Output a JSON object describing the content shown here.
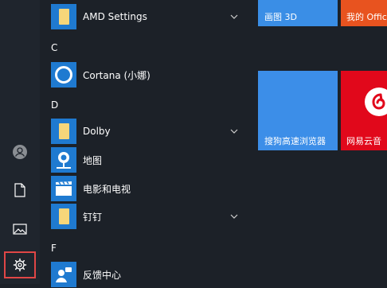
{
  "rail": {
    "items": [
      {
        "name": "user-account-button",
        "icon": "user-icon"
      },
      {
        "name": "documents-button",
        "icon": "document-icon"
      },
      {
        "name": "pictures-button",
        "icon": "image-icon"
      },
      {
        "name": "settings-button",
        "icon": "gear-icon",
        "highlighted": true
      }
    ]
  },
  "applist": {
    "amd": {
      "label": "AMD Settings",
      "icon": "folder-icon"
    },
    "header_c": "C",
    "cortana": {
      "label": "Cortana (小娜)",
      "icon": "cortana-ring-icon"
    },
    "header_d": "D",
    "dolby": {
      "label": "Dolby",
      "icon": "folder-icon"
    },
    "maps": {
      "label": "地图",
      "icon": "map-pin-icon"
    },
    "movies": {
      "label": "电影和电视",
      "icon": "clapperboard-icon"
    },
    "dingtalk": {
      "label": "钉钉",
      "icon": "folder-icon"
    },
    "header_f": "F",
    "feedback": {
      "label": "反馈中心",
      "icon": "feedback-person-icon"
    }
  },
  "tiles": {
    "paint3d": {
      "label": "画图 3D",
      "color": "#3a8ee6"
    },
    "office": {
      "label": "我的 Offic",
      "color": "#e8531f"
    },
    "sogou": {
      "label": "搜狗高速浏览器",
      "color": "#3c8ee8"
    },
    "netease": {
      "label": "网易云音",
      "color": "#e1081b"
    }
  },
  "colors": {
    "background": "#1c2128",
    "accent": "#1f7ad0",
    "folder": "#f6d67a",
    "highlight": "#e04646"
  }
}
